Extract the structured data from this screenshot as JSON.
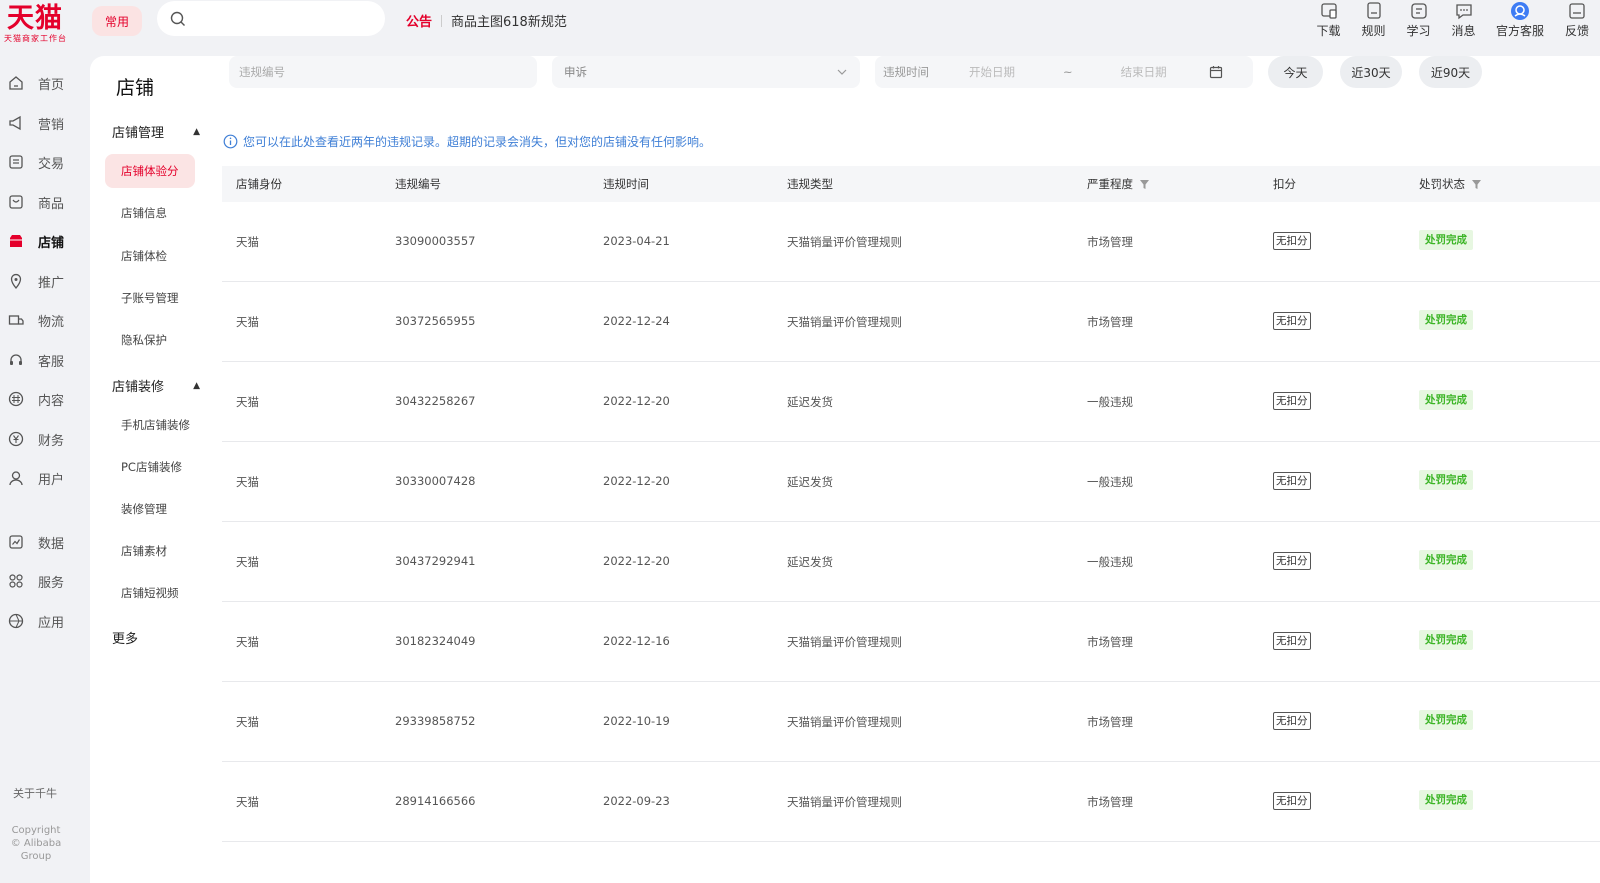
{
  "brand": {
    "logo": "天猫",
    "subtitle": "天猫商家工作台",
    "accent": "#e4002b"
  },
  "topbar": {
    "common_label": "常用",
    "search_placeholder": "",
    "notice_tag": "公告",
    "notice_text": "商品主图618新规范",
    "tools": [
      {
        "label": "下载",
        "icon": "download-icon"
      },
      {
        "label": "规则",
        "icon": "rules-icon"
      },
      {
        "label": "学习",
        "icon": "learn-icon"
      },
      {
        "label": "消息",
        "icon": "message-icon"
      },
      {
        "label": "官方客服",
        "icon": "support-icon"
      },
      {
        "label": "反馈",
        "icon": "feedback-icon"
      }
    ]
  },
  "leftnav": {
    "items": [
      {
        "label": "首页",
        "icon": "home-icon"
      },
      {
        "label": "营销",
        "icon": "megaphone-icon"
      },
      {
        "label": "交易",
        "icon": "trade-icon"
      },
      {
        "label": "商品",
        "icon": "goods-icon"
      },
      {
        "label": "店铺",
        "icon": "shop-icon"
      },
      {
        "label": "推广",
        "icon": "promote-icon"
      },
      {
        "label": "物流",
        "icon": "logistics-icon"
      },
      {
        "label": "客服",
        "icon": "headset-icon"
      },
      {
        "label": "内容",
        "icon": "content-icon"
      },
      {
        "label": "财务",
        "icon": "finance-icon"
      },
      {
        "label": "用户",
        "icon": "user-icon"
      },
      {
        "label": "数据",
        "icon": "data-icon"
      },
      {
        "label": "服务",
        "icon": "service-icon"
      },
      {
        "label": "应用",
        "icon": "apps-icon"
      }
    ],
    "active_index": 4,
    "about": "关于千牛",
    "copyright_1": "Copyright",
    "copyright_2": "© Alibaba",
    "copyright_3": "Group"
  },
  "subnav": {
    "title": "店铺",
    "group1": "店铺管理",
    "group1_items": [
      "店铺体验分",
      "店铺信息",
      "店铺体检",
      "子账号管理",
      "隐私保护"
    ],
    "group2": "店铺装修",
    "group2_items": [
      "手机店铺装修",
      "PC店铺装修",
      "装修管理",
      "店铺素材",
      "店铺短视频"
    ],
    "more": "更多"
  },
  "filters": {
    "id_placeholder": "违规编号",
    "reason_value": "申诉",
    "time_label": "违规时间",
    "start_placeholder": "开始日期",
    "range_sep": "~",
    "end_placeholder": "结束日期",
    "quick": [
      "今天",
      "近30天",
      "近90天"
    ]
  },
  "info_text": "您可以在此处查看近两年的违规记录。超期的记录会消失，但对您的店铺没有任何影响。",
  "table": {
    "headers": [
      "店铺身份",
      "违规编号",
      "违规时间",
      "违规类型",
      "严重程度",
      "扣分",
      "处罚状态"
    ],
    "rows": [
      [
        "天猫",
        "33090003557",
        "2023-04-21",
        "天猫销量评价管理规则",
        "市场管理",
        "无扣分",
        "处罚完成"
      ],
      [
        "天猫",
        "30372565955",
        "2022-12-24",
        "天猫销量评价管理规则",
        "市场管理",
        "无扣分",
        "处罚完成"
      ],
      [
        "天猫",
        "30432258267",
        "2022-12-20",
        "延迟发货",
        "一般违规",
        "无扣分",
        "处罚完成"
      ],
      [
        "天猫",
        "30330007428",
        "2022-12-20",
        "延迟发货",
        "一般违规",
        "无扣分",
        "处罚完成"
      ],
      [
        "天猫",
        "30437292941",
        "2022-12-20",
        "延迟发货",
        "一般违规",
        "无扣分",
        "处罚完成"
      ],
      [
        "天猫",
        "30182324049",
        "2022-12-16",
        "天猫销量评价管理规则",
        "市场管理",
        "无扣分",
        "处罚完成"
      ],
      [
        "天猫",
        "29339858752",
        "2022-10-19",
        "天猫销量评价管理规则",
        "市场管理",
        "无扣分",
        "处罚完成"
      ],
      [
        "天猫",
        "28914166566",
        "2022-09-23",
        "天猫销量评价管理规则",
        "市场管理",
        "无扣分",
        "处罚完成"
      ]
    ]
  },
  "colors": {
    "status_green": "#3cb526",
    "status_green_bg": "#e7f7e1",
    "info_blue": "#3f7fd6"
  }
}
